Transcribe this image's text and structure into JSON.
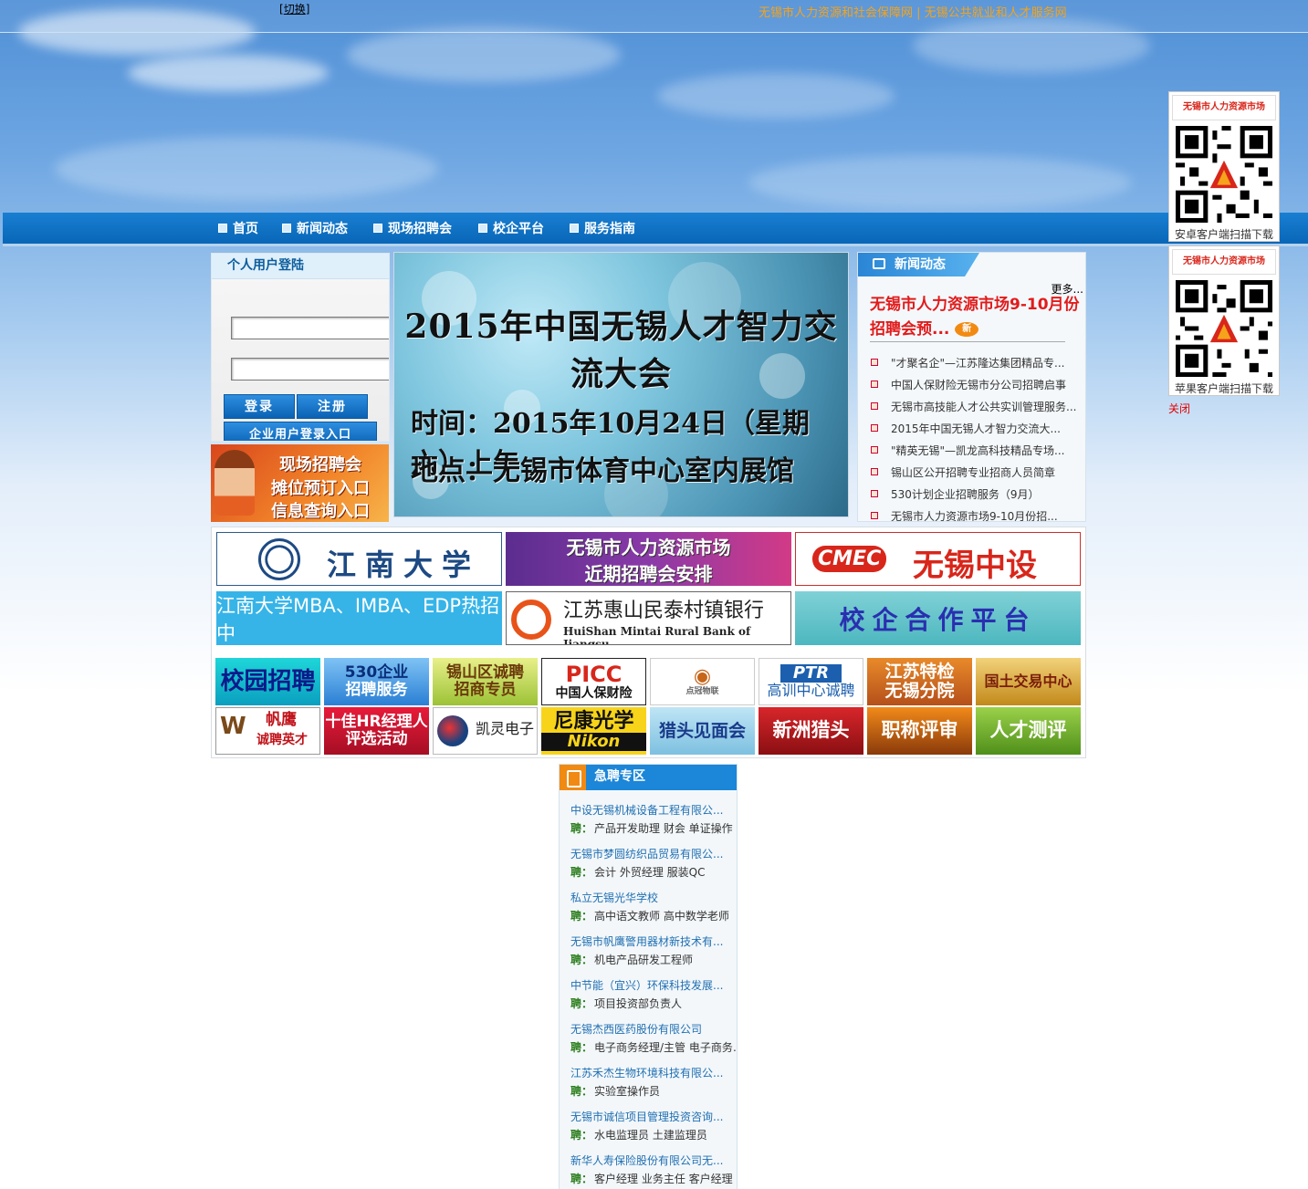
{
  "top": {
    "switch_label": "切换",
    "site_links": "无锡市人力资源和社会保障网 | 无锡公共就业和人才服务网"
  },
  "nav": {
    "items": [
      {
        "label": "首页"
      },
      {
        "label": "新闻动态"
      },
      {
        "label": "现场招聘会"
      },
      {
        "label": "校企平台"
      },
      {
        "label": "服务指南"
      }
    ]
  },
  "qr": {
    "android": {
      "title": "无锡市人力资源市场",
      "caption": "安卓客户端扫描下载"
    },
    "ios": {
      "title": "无锡市人力资源市场",
      "caption": "苹果客户端扫描下载"
    },
    "close_label": "关闭"
  },
  "login": {
    "title": "个人用户登陆",
    "login_button": "登录",
    "register_button": "注册",
    "enterprise_button": "企业用户登录入口"
  },
  "promo": {
    "line1": "现场招聘会",
    "line2": "摊位预订入口",
    "line3": "信息查询入口"
  },
  "banner": {
    "title": "2015年中国无锡人才智力交流大会",
    "time": "时间：2015年10月24日（星期六）上午",
    "place": "地点：无锡市体育中心室内展馆"
  },
  "news": {
    "tab_label": "新闻动态",
    "more_label": "更多...",
    "headline": "无锡市人力资源市场9-10月份招聘会预...",
    "new_badge": "新",
    "items": [
      "\"才聚名企\"—江苏隆达集团精品专...",
      "中国人保财险无锡市分公司招聘启事",
      "无锡市高技能人才公共实训管理服务...",
      "2015年中国无锡人才智力交流大...",
      "\"精英无锡\"—凯龙高科技精品专场...",
      "锡山区公开招聘专业招商人员简章",
      "530计划企业招聘服务（9月）",
      "无锡市人力资源市场9-10月份招..."
    ]
  },
  "big_ads": {
    "jiangnan": "江南大学",
    "market_line1": "无锡市人力资源市场",
    "market_line2": "近期招聘会安排",
    "cmec_logo": "CMEC",
    "cmec_name": "无锡中设",
    "mba": "江南大学MBA、IMBA、EDP热招中",
    "bank_cn": "江苏惠山民泰村镇银行",
    "bank_en": "HuiShan Mintai Rural Bank of Jiangsu",
    "school_platform": "校企合作平台"
  },
  "small_ads": {
    "campus": "校园招聘",
    "ad530_line1": "530企业",
    "ad530_line2": "招聘服务",
    "xishan_line1": "锡山区诚聘",
    "xishan_line2": "招商专员",
    "picc_logo": "PICC",
    "picc_name": "中国人保财险",
    "dianguan": "点冠物联",
    "ptr_logo": "PTR",
    "ptr_name": "高训中心诚聘",
    "tejian_line1": "江苏特检",
    "tejian_line2": "无锡分院",
    "land": "国土交易中心",
    "fanying_name": "帆鹰",
    "fanying_slogan": "诚聘英才",
    "hr_line1": "十佳HR经理人",
    "hr_line2": "评选活动",
    "kailing": "凯灵电子",
    "nikon_cn": "尼康光学",
    "nikon_en": "Nikon",
    "headhunt_meet": "猎头见面会",
    "xinzhou": "新洲猎头",
    "title_review": "职称评审",
    "talent_eval": "人才测评"
  },
  "urgent": {
    "title": "急聘专区",
    "pin_label": "聘：",
    "jobs": [
      {
        "company": "中设无锡机械设备工程有限公...",
        "positions": "产品开发助理  财会  单证操作"
      },
      {
        "company": "无锡市梦圆纺织品贸易有限公...",
        "positions": "会计  外贸经理  服装QC"
      },
      {
        "company": "私立无锡光华学校",
        "positions": "高中语文教师  高中数学老师"
      },
      {
        "company": "无锡市帆鹰警用器材新技术有...",
        "positions": "机电产品研发工程师"
      },
      {
        "company": "中节能（宜兴）环保科技发展...",
        "positions": "项目投资部负责人"
      },
      {
        "company": "无锡杰西医药股份有限公司",
        "positions": "电子商务经理/主管  电子商务…"
      },
      {
        "company": "江苏禾杰生物环境科技有限公...",
        "positions": "实验室操作员"
      },
      {
        "company": "无锡市诚信项目管理投资咨询...",
        "positions": "水电监理员  土建监理员"
      },
      {
        "company": "新华人寿保险股份有限公司无...",
        "positions": "客户经理  业务主任  客户经理"
      }
    ]
  }
}
